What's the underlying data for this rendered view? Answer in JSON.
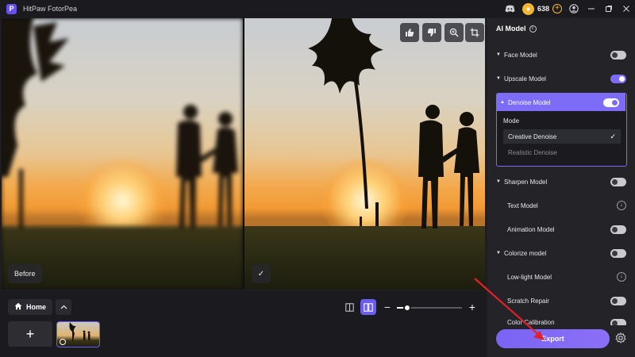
{
  "app": {
    "title": "HitPaw FotorPea",
    "logo_letter": "P"
  },
  "titlebar": {
    "credits": "638",
    "plus": "+",
    "icons": [
      "discord-icon",
      "coin-icon",
      "add-credits-icon",
      "account-icon",
      "minimize-icon",
      "maximize-icon",
      "close-icon"
    ]
  },
  "preview": {
    "before_label": "Before",
    "check_label": "✓",
    "tools": [
      "thumbs-up-icon",
      "thumbs-down-icon",
      "zoom-icon",
      "crop-icon"
    ]
  },
  "bottom": {
    "home_label": "Home",
    "up_label": "⌃",
    "add_label": "+",
    "zoom_minus": "−",
    "zoom_plus": "+",
    "zoom_level": 0.16
  },
  "panel": {
    "title": "AI Model",
    "rows": [
      {
        "label": "Face Model",
        "state": "off",
        "caret": "▼"
      },
      {
        "label": "Upscale Model",
        "state": "on",
        "caret": "▼"
      }
    ],
    "denoise": {
      "label": "Denoise Model",
      "caret": "▲",
      "state": "on",
      "mode_label": "Mode",
      "options": [
        {
          "label": "Creative Denoise",
          "selected": true,
          "tick": "✓"
        },
        {
          "label": "Realistic Denoise",
          "selected": false
        }
      ]
    },
    "rows2": [
      {
        "label": "Sharpen Model",
        "state": "off",
        "caret": "▼",
        "sub": false,
        "control": "toggle"
      },
      {
        "label": "Text Model",
        "state": "download",
        "sub": true,
        "control": "download"
      },
      {
        "label": "Animation Model",
        "state": "off",
        "sub": true,
        "control": "toggle"
      },
      {
        "label": "Colorize model",
        "state": "off",
        "caret": "▼",
        "sub": false,
        "control": "toggle"
      },
      {
        "label": "Low-light Model",
        "state": "download",
        "sub": true,
        "control": "download"
      },
      {
        "label": "Scratch Repair",
        "state": "off",
        "sub": true,
        "control": "toggle"
      },
      {
        "label": "Color Calibration",
        "state": "off",
        "sub": true,
        "control": "toggle"
      }
    ],
    "export_label": "Export"
  },
  "colors": {
    "accent": "#7c6cf7",
    "coin": "#f5b731",
    "annotation": "#e0202a"
  }
}
